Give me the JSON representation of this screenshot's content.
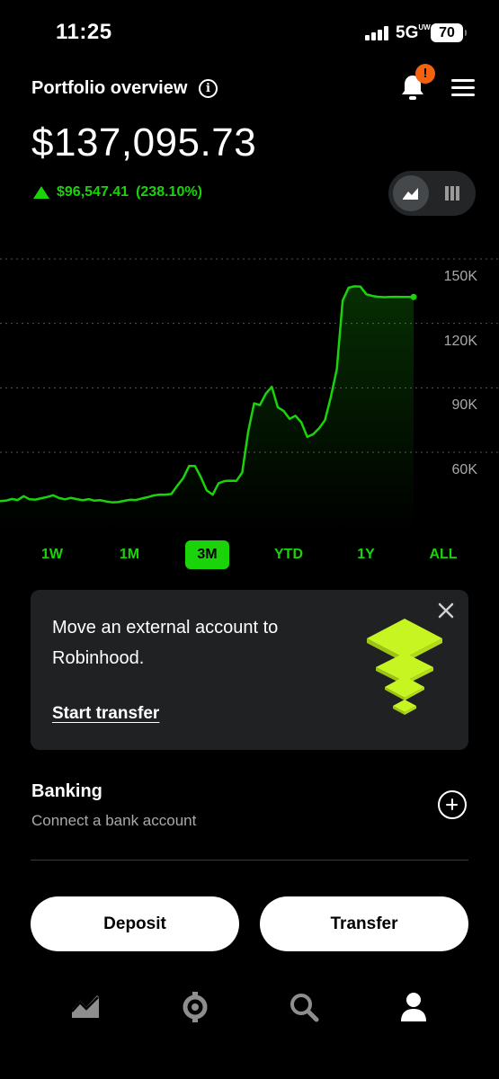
{
  "status_bar": {
    "time": "11:25",
    "network": "5G",
    "network_sup": "UW",
    "battery": "70"
  },
  "header": {
    "title": "Portfolio overview"
  },
  "notifications": {
    "badge": "!"
  },
  "portfolio": {
    "balance": "$137,095.73",
    "change_amount": "$96,547.41",
    "change_percent": "(238.10%)"
  },
  "colors": {
    "accent": "#1bd30a",
    "badge": "#f5620f",
    "card_bg": "#1f2123",
    "promo_art": "#c7f521"
  },
  "chart_data": {
    "type": "line",
    "y_ticks": [
      "150K",
      "120K",
      "90K",
      "60K"
    ],
    "ylim": [
      45000,
      155000
    ],
    "grid": "dotted horizontal",
    "x": [
      0,
      1,
      2,
      3,
      4,
      5,
      6,
      7,
      8,
      9,
      10,
      11,
      12,
      13,
      14,
      15,
      16,
      17,
      18,
      19,
      20,
      21,
      22,
      23,
      24,
      25,
      26,
      27,
      28,
      29,
      30,
      31,
      32,
      33,
      34,
      35,
      36,
      37,
      38,
      39,
      40,
      41,
      42,
      43,
      44,
      45,
      46,
      47,
      48,
      49,
      50,
      51,
      52,
      53,
      54,
      55,
      56,
      57,
      58,
      59,
      60,
      61,
      62,
      63,
      64,
      65,
      66,
      67,
      68,
      69,
      70
    ],
    "values": [
      46500,
      46700,
      47500,
      47000,
      48800,
      47300,
      47200,
      47800,
      48400,
      49200,
      47900,
      47300,
      48000,
      47400,
      46900,
      47400,
      46700,
      46900,
      46300,
      45900,
      46000,
      46600,
      47100,
      47000,
      47700,
      48300,
      49100,
      49500,
      49500,
      49800,
      53600,
      57100,
      62800,
      62800,
      57600,
      51400,
      49500,
      54800,
      55800,
      56000,
      55900,
      59800,
      78700,
      92000,
      91200,
      96500,
      99700,
      90200,
      88500,
      84800,
      86200,
      83200,
      76400,
      77600,
      80400,
      84100,
      95000,
      107900,
      139800,
      145800,
      146500,
      146300,
      142800,
      142000,
      141600,
      141400,
      141500,
      141600,
      141500,
      141500,
      141500
    ],
    "series_color": "#1bd30a"
  },
  "range_tabs": {
    "items": [
      "1W",
      "1M",
      "3M",
      "YTD",
      "1Y",
      "ALL"
    ],
    "active": "3M"
  },
  "promo_card": {
    "text": "Move an external account to Robinhood.",
    "link": "Start transfer"
  },
  "banking": {
    "title": "Banking",
    "subtitle": "Connect a bank account"
  },
  "actions": {
    "deposit": "Deposit",
    "transfer": "Transfer"
  },
  "bottom_nav": {
    "icons": [
      "investing-chart-icon",
      "crypto-icon",
      "search-icon",
      "account-icon"
    ],
    "active": "account-icon"
  }
}
